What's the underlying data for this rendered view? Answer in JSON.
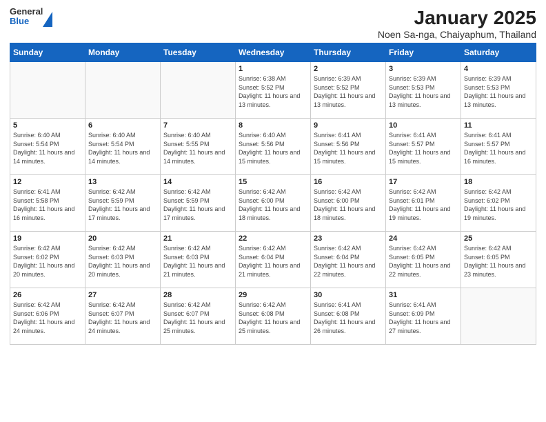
{
  "logo": {
    "general": "General",
    "blue": "Blue"
  },
  "title": "January 2025",
  "subtitle": "Noen Sa-nga, Chaiyaphum, Thailand",
  "days_of_week": [
    "Sunday",
    "Monday",
    "Tuesday",
    "Wednesday",
    "Thursday",
    "Friday",
    "Saturday"
  ],
  "weeks": [
    [
      {
        "day": "",
        "sunrise": "",
        "sunset": "",
        "daylight": ""
      },
      {
        "day": "",
        "sunrise": "",
        "sunset": "",
        "daylight": ""
      },
      {
        "day": "",
        "sunrise": "",
        "sunset": "",
        "daylight": ""
      },
      {
        "day": "1",
        "sunrise": "Sunrise: 6:38 AM",
        "sunset": "Sunset: 5:52 PM",
        "daylight": "Daylight: 11 hours and 13 minutes."
      },
      {
        "day": "2",
        "sunrise": "Sunrise: 6:39 AM",
        "sunset": "Sunset: 5:52 PM",
        "daylight": "Daylight: 11 hours and 13 minutes."
      },
      {
        "day": "3",
        "sunrise": "Sunrise: 6:39 AM",
        "sunset": "Sunset: 5:53 PM",
        "daylight": "Daylight: 11 hours and 13 minutes."
      },
      {
        "day": "4",
        "sunrise": "Sunrise: 6:39 AM",
        "sunset": "Sunset: 5:53 PM",
        "daylight": "Daylight: 11 hours and 13 minutes."
      }
    ],
    [
      {
        "day": "5",
        "sunrise": "Sunrise: 6:40 AM",
        "sunset": "Sunset: 5:54 PM",
        "daylight": "Daylight: 11 hours and 14 minutes."
      },
      {
        "day": "6",
        "sunrise": "Sunrise: 6:40 AM",
        "sunset": "Sunset: 5:54 PM",
        "daylight": "Daylight: 11 hours and 14 minutes."
      },
      {
        "day": "7",
        "sunrise": "Sunrise: 6:40 AM",
        "sunset": "Sunset: 5:55 PM",
        "daylight": "Daylight: 11 hours and 14 minutes."
      },
      {
        "day": "8",
        "sunrise": "Sunrise: 6:40 AM",
        "sunset": "Sunset: 5:56 PM",
        "daylight": "Daylight: 11 hours and 15 minutes."
      },
      {
        "day": "9",
        "sunrise": "Sunrise: 6:41 AM",
        "sunset": "Sunset: 5:56 PM",
        "daylight": "Daylight: 11 hours and 15 minutes."
      },
      {
        "day": "10",
        "sunrise": "Sunrise: 6:41 AM",
        "sunset": "Sunset: 5:57 PM",
        "daylight": "Daylight: 11 hours and 15 minutes."
      },
      {
        "day": "11",
        "sunrise": "Sunrise: 6:41 AM",
        "sunset": "Sunset: 5:57 PM",
        "daylight": "Daylight: 11 hours and 16 minutes."
      }
    ],
    [
      {
        "day": "12",
        "sunrise": "Sunrise: 6:41 AM",
        "sunset": "Sunset: 5:58 PM",
        "daylight": "Daylight: 11 hours and 16 minutes."
      },
      {
        "day": "13",
        "sunrise": "Sunrise: 6:42 AM",
        "sunset": "Sunset: 5:59 PM",
        "daylight": "Daylight: 11 hours and 17 minutes."
      },
      {
        "day": "14",
        "sunrise": "Sunrise: 6:42 AM",
        "sunset": "Sunset: 5:59 PM",
        "daylight": "Daylight: 11 hours and 17 minutes."
      },
      {
        "day": "15",
        "sunrise": "Sunrise: 6:42 AM",
        "sunset": "Sunset: 6:00 PM",
        "daylight": "Daylight: 11 hours and 18 minutes."
      },
      {
        "day": "16",
        "sunrise": "Sunrise: 6:42 AM",
        "sunset": "Sunset: 6:00 PM",
        "daylight": "Daylight: 11 hours and 18 minutes."
      },
      {
        "day": "17",
        "sunrise": "Sunrise: 6:42 AM",
        "sunset": "Sunset: 6:01 PM",
        "daylight": "Daylight: 11 hours and 19 minutes."
      },
      {
        "day": "18",
        "sunrise": "Sunrise: 6:42 AM",
        "sunset": "Sunset: 6:02 PM",
        "daylight": "Daylight: 11 hours and 19 minutes."
      }
    ],
    [
      {
        "day": "19",
        "sunrise": "Sunrise: 6:42 AM",
        "sunset": "Sunset: 6:02 PM",
        "daylight": "Daylight: 11 hours and 20 minutes."
      },
      {
        "day": "20",
        "sunrise": "Sunrise: 6:42 AM",
        "sunset": "Sunset: 6:03 PM",
        "daylight": "Daylight: 11 hours and 20 minutes."
      },
      {
        "day": "21",
        "sunrise": "Sunrise: 6:42 AM",
        "sunset": "Sunset: 6:03 PM",
        "daylight": "Daylight: 11 hours and 21 minutes."
      },
      {
        "day": "22",
        "sunrise": "Sunrise: 6:42 AM",
        "sunset": "Sunset: 6:04 PM",
        "daylight": "Daylight: 11 hours and 21 minutes."
      },
      {
        "day": "23",
        "sunrise": "Sunrise: 6:42 AM",
        "sunset": "Sunset: 6:04 PM",
        "daylight": "Daylight: 11 hours and 22 minutes."
      },
      {
        "day": "24",
        "sunrise": "Sunrise: 6:42 AM",
        "sunset": "Sunset: 6:05 PM",
        "daylight": "Daylight: 11 hours and 22 minutes."
      },
      {
        "day": "25",
        "sunrise": "Sunrise: 6:42 AM",
        "sunset": "Sunset: 6:05 PM",
        "daylight": "Daylight: 11 hours and 23 minutes."
      }
    ],
    [
      {
        "day": "26",
        "sunrise": "Sunrise: 6:42 AM",
        "sunset": "Sunset: 6:06 PM",
        "daylight": "Daylight: 11 hours and 24 minutes."
      },
      {
        "day": "27",
        "sunrise": "Sunrise: 6:42 AM",
        "sunset": "Sunset: 6:07 PM",
        "daylight": "Daylight: 11 hours and 24 minutes."
      },
      {
        "day": "28",
        "sunrise": "Sunrise: 6:42 AM",
        "sunset": "Sunset: 6:07 PM",
        "daylight": "Daylight: 11 hours and 25 minutes."
      },
      {
        "day": "29",
        "sunrise": "Sunrise: 6:42 AM",
        "sunset": "Sunset: 6:08 PM",
        "daylight": "Daylight: 11 hours and 25 minutes."
      },
      {
        "day": "30",
        "sunrise": "Sunrise: 6:41 AM",
        "sunset": "Sunset: 6:08 PM",
        "daylight": "Daylight: 11 hours and 26 minutes."
      },
      {
        "day": "31",
        "sunrise": "Sunrise: 6:41 AM",
        "sunset": "Sunset: 6:09 PM",
        "daylight": "Daylight: 11 hours and 27 minutes."
      },
      {
        "day": "",
        "sunrise": "",
        "sunset": "",
        "daylight": ""
      }
    ]
  ]
}
